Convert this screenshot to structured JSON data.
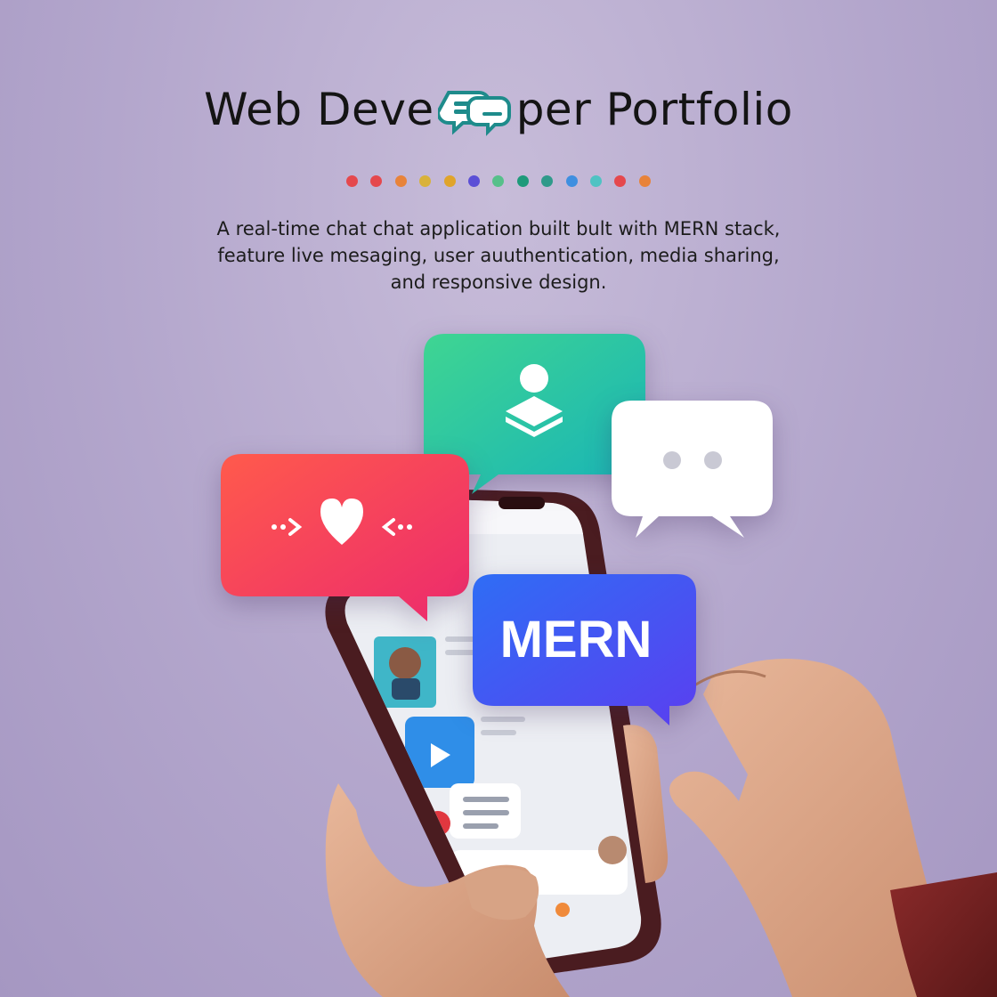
{
  "header": {
    "title_part1": "Web Deve",
    "title_part2": "per Portfolio",
    "logo_icon": "chat-bubbles-logo-icon"
  },
  "dot_colors": [
    "#e5484d",
    "#e5484d",
    "#e8833a",
    "#d9b23a",
    "#e0a42b",
    "#5b4fd6",
    "#56c08a",
    "#1e9a7a",
    "#2f9a8a",
    "#3f8fe0",
    "#4fc3c3",
    "#e5484d",
    "#e8833a"
  ],
  "description": {
    "line1": "A real-time chat chat application  built bult with MERN stack,",
    "line2": "feature  live mesaging, user auuthentication, media sharing,",
    "line3": "and responsive design."
  },
  "bubbles": {
    "teal": {
      "icon": "user-layers-icon",
      "color_start": "#3fd592",
      "color_end": "#17b3b8"
    },
    "white": {
      "icon": "typing-dots-icon",
      "color": "#ffffff"
    },
    "red": {
      "icon": "heart-arrows-icon",
      "color_start": "#ff5a4c",
      "color_end": "#ec2a6d"
    },
    "blue": {
      "label": "MERN",
      "color_start": "#2f6df5",
      "color_end": "#5a3ff0"
    }
  },
  "phone": {
    "screen_icons": [
      "play-icon",
      "video-thumbnail",
      "avatar",
      "message-lines-icon"
    ]
  }
}
